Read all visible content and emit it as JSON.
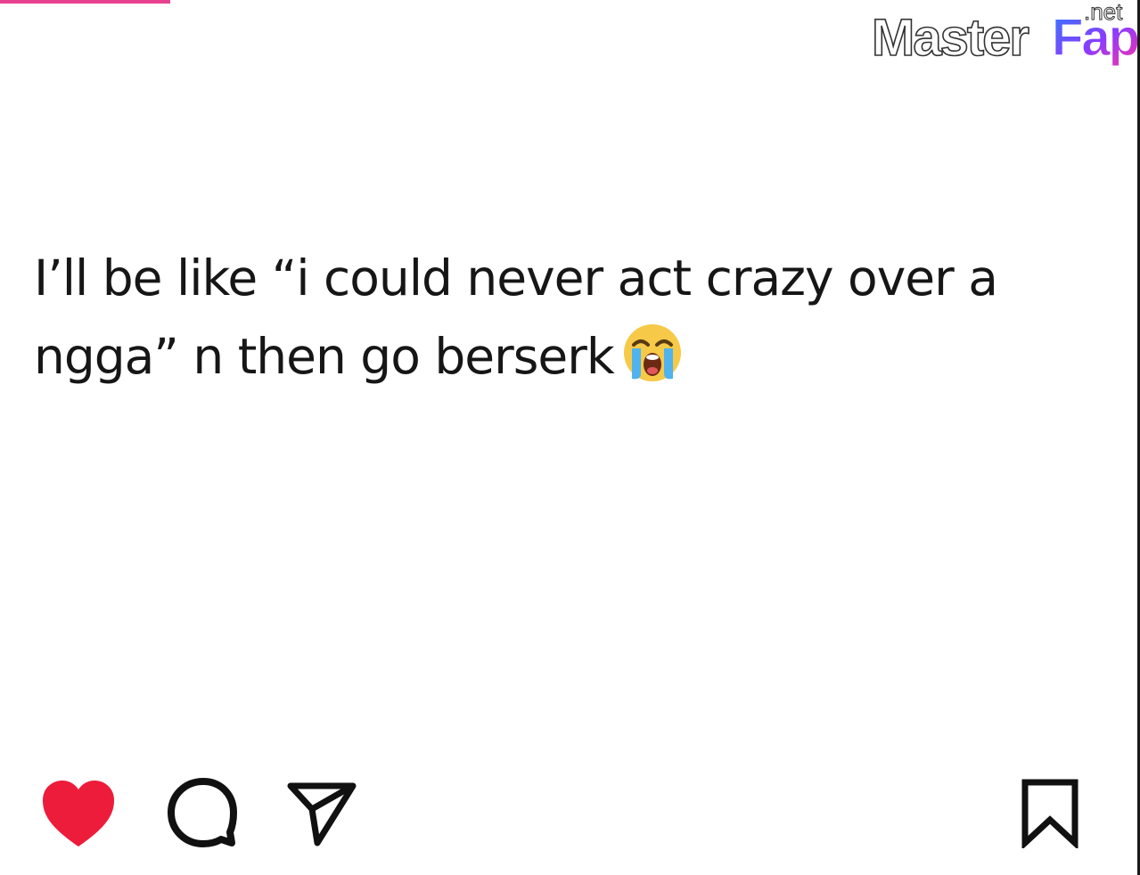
{
  "watermark": {
    "brand": "MasterFap",
    "suffix": ".net"
  },
  "post": {
    "line1": "I’ll be like “i could never act crazy over a",
    "line2": "ngga” n then go berserk",
    "emoji": "loudly-crying-face-emoji"
  },
  "actions": {
    "like_icon": "heart-filled-icon",
    "comment_icon": "comment-bubble-icon",
    "share_icon": "paper-plane-icon",
    "save_icon": "bookmark-icon",
    "like_color": "#ed1c3a"
  },
  "colors": {
    "accent_pink": "#e8418f",
    "text": "#161616"
  }
}
